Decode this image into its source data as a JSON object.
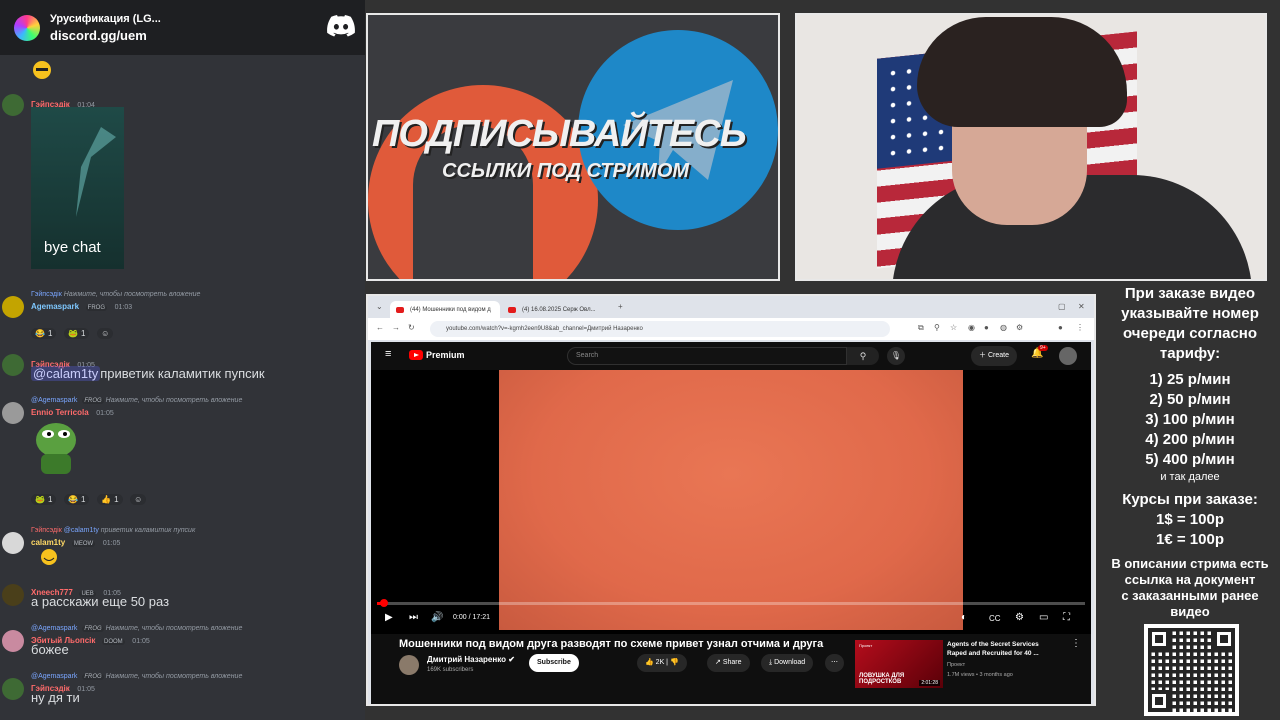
{
  "discord": {
    "server_name": "Урусификация (LG...",
    "invite": "discord.gg/uem",
    "messages": [
      {
        "user": "Гэйпсэдік",
        "time": "01:04",
        "image_caption": "bye chat"
      },
      {
        "reply_user": "Гэйпсэдік",
        "reply_text": "Нажмите, чтобы посмотреть вложение",
        "user": "Agemaspark",
        "badge": "FROG",
        "time": "01:03",
        "reactions": [
          "1",
          "1"
        ]
      },
      {
        "user": "Гэйпсэдік",
        "time": "01:05",
        "mention": "@calam1ty",
        "text": "приветик каламитик пупсик"
      },
      {
        "reply_user": "@Agemaspark",
        "reply_badge": "FROG",
        "reply_text": "Нажмите, чтобы посмотреть вложение",
        "user": "Ennio Terricola",
        "time": "01:05",
        "reactions": [
          "1",
          "1",
          "1"
        ]
      },
      {
        "reply_user": "Гэйпсэдік",
        "reply_mention": "@calam1ty",
        "reply_text": "приветик каламитик пупсик",
        "user": "calam1ty",
        "badge": "MEOW",
        "time": "01:05"
      },
      {
        "user": "Xneech777",
        "badge": "UEB",
        "time": "01:05",
        "text": "а расскажи еще 50 раз"
      },
      {
        "reply_user": "@Agemaspark",
        "reply_badge": "FROG",
        "reply_text": "Нажмите, чтобы посмотреть вложение",
        "user": "Эбитый Льопсік",
        "badge": "DOOM",
        "time": "01:05",
        "text": "божее"
      },
      {
        "reply_user": "@Agemaspark",
        "reply_badge": "FROG",
        "reply_text": "Нажмите, чтобы посмотреть вложение",
        "user": "Гэйпсэдік",
        "time": "01:05",
        "text": "ну дя ти"
      }
    ]
  },
  "promo": {
    "headline": "ПОДПИСЫВАЙТЕСЬ",
    "subline": "ССЫЛКИ ПОД СТРИМОМ"
  },
  "browser": {
    "tab1": "(44) Мошенники под видом д",
    "tab2": "(4) 16.08.2025 Серж Овл...",
    "url": "youtube.com/watch?v=-kgmh2een9U8&ab_channel=Дмитрий Назаренко"
  },
  "youtube": {
    "logo_label": "Premium",
    "search_placeholder": "Search",
    "create_label": "Create",
    "bell_badge": "9+",
    "time": "0:00 / 17:21",
    "progress_fraction": 0.005,
    "video_title": "Мошенники под видом друга разводят по схеме привет узнал отчима и друга",
    "channel_name": "Дмитрий Назаренко",
    "subscribers": "169K subscribers",
    "subscribe_label": "Subscribe",
    "likes": "2K",
    "share_label": "Share",
    "download_label": "Download",
    "rec_thumb_title": "ЛОВУШКА ДЛЯ ПОДРОСТКОВ",
    "rec_thumb_label": "Проект",
    "rec_duration": "2:01:28",
    "rec_title": "Agents of the Secret Services Raped and Recruited for 40 ...",
    "rec_channel": "Проект",
    "rec_meta": "1.7M views • 3 months ago"
  },
  "info": {
    "intro": [
      "При заказе видео",
      "указывайте номер",
      "очереди согласно",
      "тарифу:"
    ],
    "tariffs": [
      "1) 25 р/мин",
      "2) 50 р/мин",
      "3) 100 р/мин",
      "4) 200 р/мин",
      "5) 400 р/мин"
    ],
    "and_so_on": "и так далее",
    "rates_title": "Курсы при заказе:",
    "rates": [
      "1$ = 100р",
      "1€ = 100р"
    ],
    "doc_note": [
      "В описании стрима есть",
      "ссылка на документ",
      "с заказанными ранее",
      "видео"
    ]
  },
  "colors": {
    "discord_bg": "#313338",
    "youtube_red": "#ff0000",
    "video_frame": "#e0694a",
    "telegram_blue": "#1e88c8",
    "patreon_red": "#e05a3a"
  }
}
